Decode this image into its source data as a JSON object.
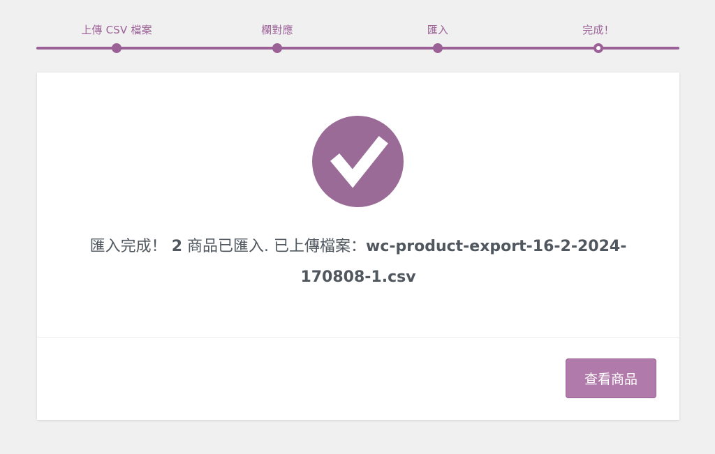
{
  "steps": {
    "items": [
      {
        "label": "上傳 CSV 檔案",
        "state": "done"
      },
      {
        "label": "欄對應",
        "state": "done"
      },
      {
        "label": "匯入",
        "state": "done"
      },
      {
        "label": "完成！",
        "state": "current"
      }
    ]
  },
  "result": {
    "message_prefix": "匯入完成！",
    "count_text": "2",
    "message_middle": "商品已匯入. 已上傳檔案：",
    "file_line1": "wc-product-export-16-2-2024-",
    "file_line2": "170808-1.csv"
  },
  "actions": {
    "view_products_label": "查看商品"
  },
  "colors": {
    "accent": "#9b6196",
    "button": "#b07aaa",
    "check_circle": "#9b6b97",
    "background": "#f0f0f1",
    "text": "#50575e"
  },
  "icons": {
    "success": "checkmark-icon"
  }
}
